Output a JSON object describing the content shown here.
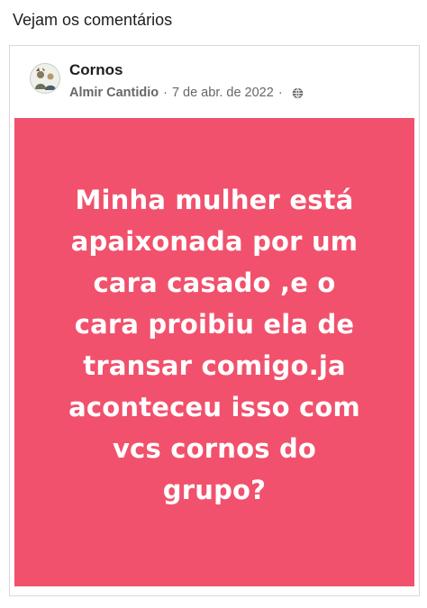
{
  "caption": "Vejam os comentários",
  "post": {
    "group_name": "Cornos",
    "author": "Almir Cantidio",
    "separator": "·",
    "date": "7 de abr. de 2022",
    "privacy_icon": "globe-icon",
    "avatar_icon": "group-avatar-icon",
    "background_color": "#f1516c",
    "text_lines": [
      "Minha mulher está",
      "apaixonada por um",
      "cara casado ,e o",
      "cara proibiu ela de",
      "transar comigo.ja",
      "aconteceu isso com",
      "vcs cornos do",
      "grupo?"
    ]
  }
}
